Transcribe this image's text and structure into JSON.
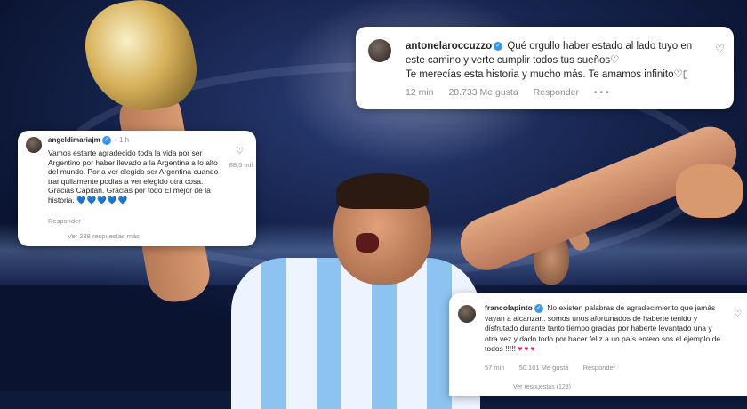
{
  "comments": {
    "antonela": {
      "username": "antonelaroccuzzo",
      "verified_badge": "✓",
      "line1": "Qué orgullo haber estado al lado tuyo en este camino y verte cumplir todos tus sueños♡",
      "line2": "Te merecías esta historia y mucho más. Te amamos infinito♡▯",
      "time": "12 min",
      "likes": "28.733 Me gusta",
      "reply": "Responder",
      "more_dots": "• • •",
      "like_icon": "♡"
    },
    "angel": {
      "username": "angeldimariajm",
      "verified_badge": "✓",
      "time": "• 1 h",
      "body": "Vamos estarte agradecido toda la vida por ser Argentino por haber llevado a la Argentina a lo alto del mundo. Por a ver elegido ser Argentina cuando tranquilamente podias a ver elegido otra cosa. Gracias Capitán. Gracias por todo El mejor de la historia.",
      "emoji_hearts": "💙💙💙💙💙",
      "like_icon": "♡",
      "likes": "88,5 mil",
      "reply": "Responder",
      "view_replies": "Ver 238 respuestas más"
    },
    "franco": {
      "username": "francolapinto",
      "verified_badge": "✓",
      "body": "No existen palabras de agradecimiento que jamás vayan a alcanzar.. somos unos afortunados de haberte tenido y disfrutado durante tanto tiempo gracias por haberte levantado una y otra vez y dado todo por hacer feliz a un país entero sos el ejemplo de todos !!!!!",
      "emoji_hearts": "♥♥♥",
      "like_icon": "♡",
      "time": "57 min",
      "likes": "50.101 Me gusta",
      "reply": "Responder",
      "view_replies": "Ver respuestas (128)"
    }
  }
}
